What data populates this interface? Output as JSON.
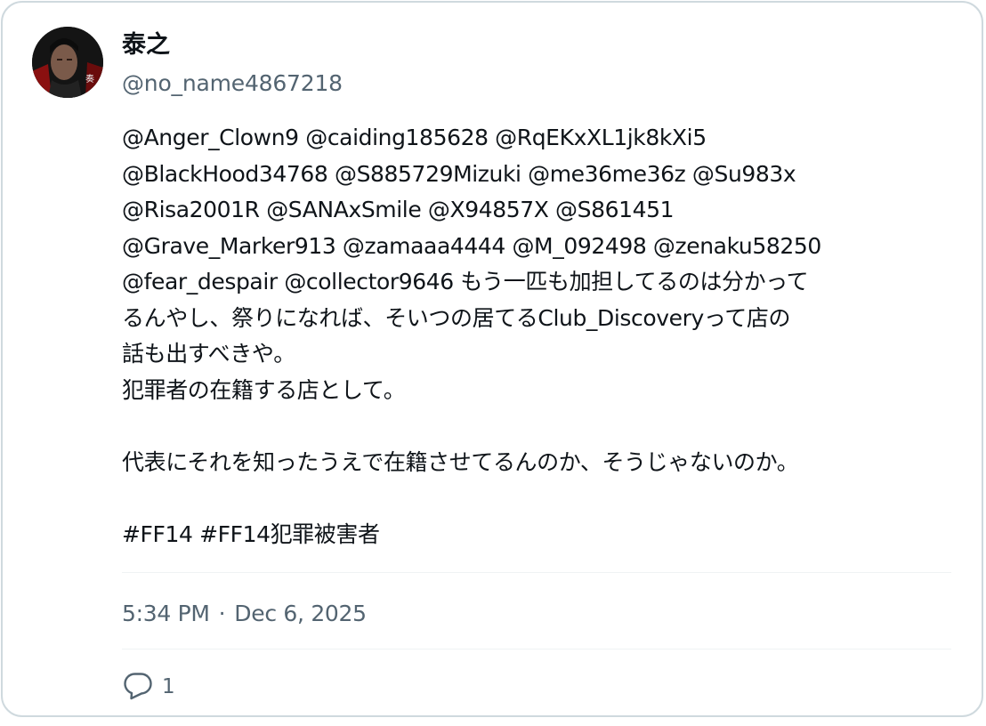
{
  "user": {
    "display_name": "泰之",
    "handle": "@no_name4867218"
  },
  "tweet": {
    "lines": [
      "@Anger_Clown9 @caiding185628 @RqEKxXL1jk8kXi5",
      "@BlackHood34768 @S885729Mizuki @me36me36z @Su983x",
      "@Risa2001R @SANAxSmile @X94857X @S861451",
      "@Grave_Marker913 @zamaaa4444 @M_092498 @zenaku58250",
      "@fear_despair @collector9646 もう一匹も加担してるのは分かって",
      "るんやし、祭りになれば、そいつの居てるClub_Discoveryって店の",
      "話も出すべきや。",
      "犯罪者の在籍する店として。",
      "",
      "代表にそれを知ったうえで在籍させてるんのか、そうじゃないのか。",
      "",
      "#FF14 #FF14犯罪被害者"
    ]
  },
  "meta": {
    "time": "5:34 PM",
    "separator": "·",
    "date": "Dec 6, 2025"
  },
  "actions": {
    "reply_icon": "reply-bubble-icon",
    "reply_count": "1"
  },
  "colors": {
    "text": "#0f1419",
    "secondary": "#536471",
    "border": "#cfd9de",
    "divider": "#eff3f4"
  }
}
